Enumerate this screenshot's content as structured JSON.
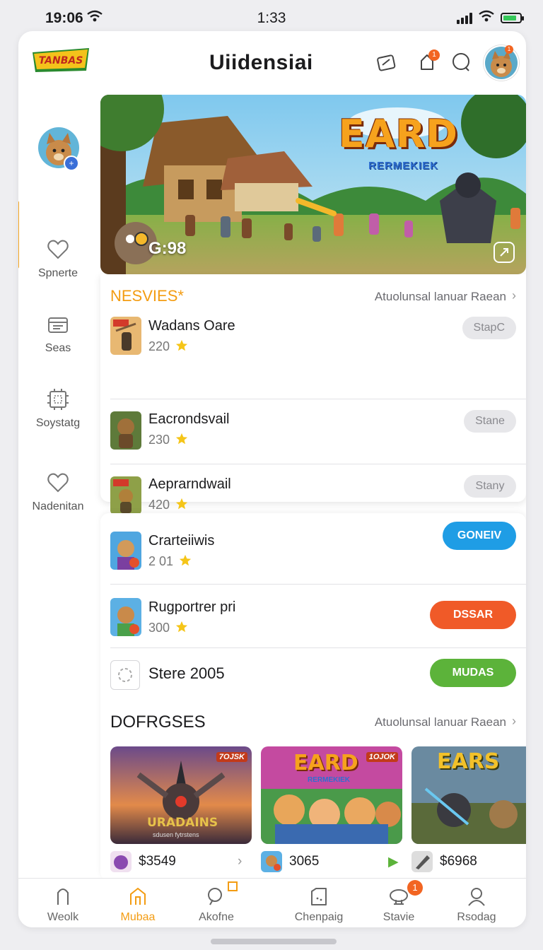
{
  "status_bar": {
    "time_left": "19:06",
    "time_center": "1:33",
    "battery_level": 0.8
  },
  "header": {
    "title": "Uiidensiai",
    "logo_text": "TANBAS",
    "notification_badge": "1",
    "avatar_badge": "1"
  },
  "sidebar": {
    "items": [
      {
        "label": "Spnerte",
        "icon": "heart-icon"
      },
      {
        "label": "Seas",
        "icon": "inbox-icon"
      },
      {
        "label": "Soystatg",
        "icon": "chip-icon"
      },
      {
        "label": "Nadenitan",
        "icon": "heart-icon"
      }
    ]
  },
  "hero": {
    "title": "EARD",
    "subtitle": "RERMEKIEK",
    "timer": "G:98"
  },
  "news": {
    "title": "NESVIES*",
    "link": "Atuolunsal lanuar Raean",
    "items": [
      {
        "title": "Wadans Oare",
        "count": "220",
        "action": "StapC"
      },
      {
        "title": "Eacrondsvail",
        "count": "230",
        "action": "Stane"
      },
      {
        "title": "Aeprarndwail",
        "count": "420",
        "action": "Stany"
      }
    ]
  },
  "actions": {
    "items": [
      {
        "title": "Crarteiiwis",
        "count": "2 01",
        "action": "GONEIV",
        "color": "#1f9de5"
      },
      {
        "title": "Rugportrer pri",
        "count": "300",
        "action": "DSSAR",
        "color": "#f05a28"
      },
      {
        "title": "Stere 2005",
        "count": "",
        "action": "MUDAS",
        "color": "#5cb33a"
      }
    ]
  },
  "dofrgses": {
    "title": "DOFRGSES",
    "link": "Atuolunsal lanuar Raean",
    "cards": [
      {
        "title": "URADAINS",
        "subtitle": "sdusen fytrstens",
        "tag": "7OJSK",
        "price": "$3549"
      },
      {
        "title": "EARD",
        "subtitle": "RERMEKIEK",
        "tag": "1OJOK",
        "price": "3065"
      },
      {
        "title": "EARS",
        "subtitle": "",
        "tag": "",
        "price": "$6968"
      }
    ]
  },
  "tabbar": {
    "tabs": [
      {
        "label": "Weolk",
        "icon": "bookmark-icon"
      },
      {
        "label": "Mubaa",
        "icon": "home-icon"
      },
      {
        "label": "Akofne",
        "icon": "search-icon"
      },
      {
        "label": "Chenpaig",
        "icon": "folder-icon"
      },
      {
        "label": "Stavie",
        "icon": "game-icon",
        "badge": "1"
      },
      {
        "label": "Rsodag",
        "icon": "user-icon"
      }
    ],
    "active_index": 1
  },
  "colors": {
    "accent": "#f39c12",
    "blue": "#1f9de5",
    "orange": "#f05a28",
    "green": "#5cb33a"
  }
}
